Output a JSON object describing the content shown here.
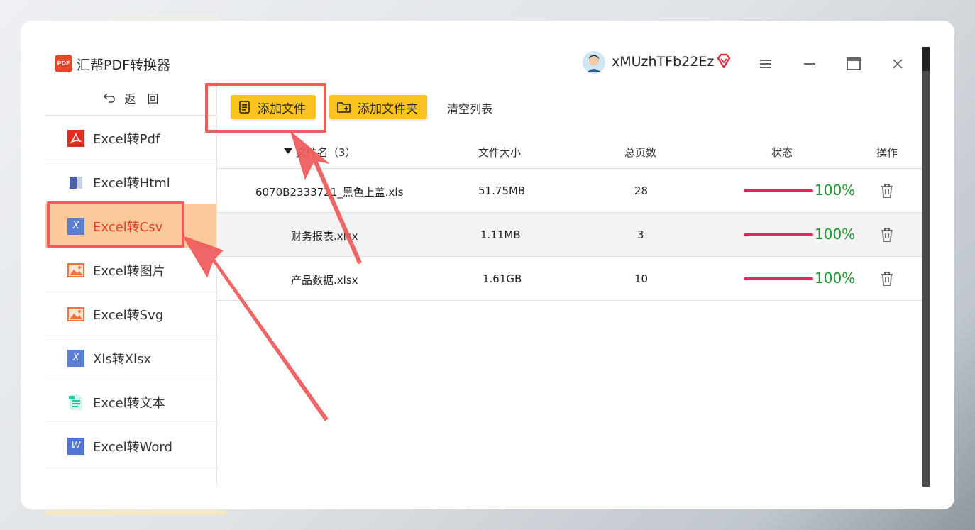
{
  "app": {
    "title": "汇帮PDF转换器",
    "logo_text": "PDF"
  },
  "user": {
    "name": "xMUzhTFb22Ez"
  },
  "window_controls": {
    "menu": "menu-icon",
    "minimize": "minimize-icon",
    "maximize": "maximize-icon",
    "close": "close-icon"
  },
  "sidebar": {
    "back_label": "返　回",
    "items": [
      {
        "label": "Excel转Pdf",
        "icon": "pdf-icon",
        "color": "#e52b1d"
      },
      {
        "label": "Excel转Html",
        "icon": "html-icon",
        "color": "#4b5fa8"
      },
      {
        "label": "Excel转Csv",
        "icon": "excel-icon",
        "color": "#5b7fd6",
        "active": true
      },
      {
        "label": "Excel转图片",
        "icon": "image-icon",
        "color": "#e8753e"
      },
      {
        "label": "Excel转Svg",
        "icon": "image-icon",
        "color": "#e8753e"
      },
      {
        "label": "Xls转Xlsx",
        "icon": "excel-icon",
        "color": "#5b7fd6"
      },
      {
        "label": "Excel转文本",
        "icon": "text-icon",
        "color": "#2fbfa0"
      },
      {
        "label": "Excel转Word",
        "icon": "word-icon",
        "color": "#4e74d4"
      }
    ]
  },
  "toolbar": {
    "add_file": "添加文件",
    "add_folder": "添加文件夹",
    "clear_list": "清空列表"
  },
  "table": {
    "headers": {
      "name": "文件名（3）",
      "size": "文件大小",
      "pages": "总页数",
      "status": "状态",
      "action": "操作"
    },
    "rows": [
      {
        "name": "6070B2333721_黑色上盖.xls",
        "size": "51.75MB",
        "pages": "28",
        "progress": "100%"
      },
      {
        "name": "财务报表.xlsx",
        "size": "1.11MB",
        "pages": "3",
        "progress": "100%"
      },
      {
        "name": "产品数据.xlsx",
        "size": "1.61GB",
        "pages": "10",
        "progress": "100%"
      }
    ]
  },
  "colors": {
    "accent": "#f9c21e",
    "active_bg": "#fcc99a",
    "active_text": "#e83a26",
    "progress": "#d92b5a",
    "percent_text": "#1f9a32",
    "annotation": "#ef5a5a"
  }
}
